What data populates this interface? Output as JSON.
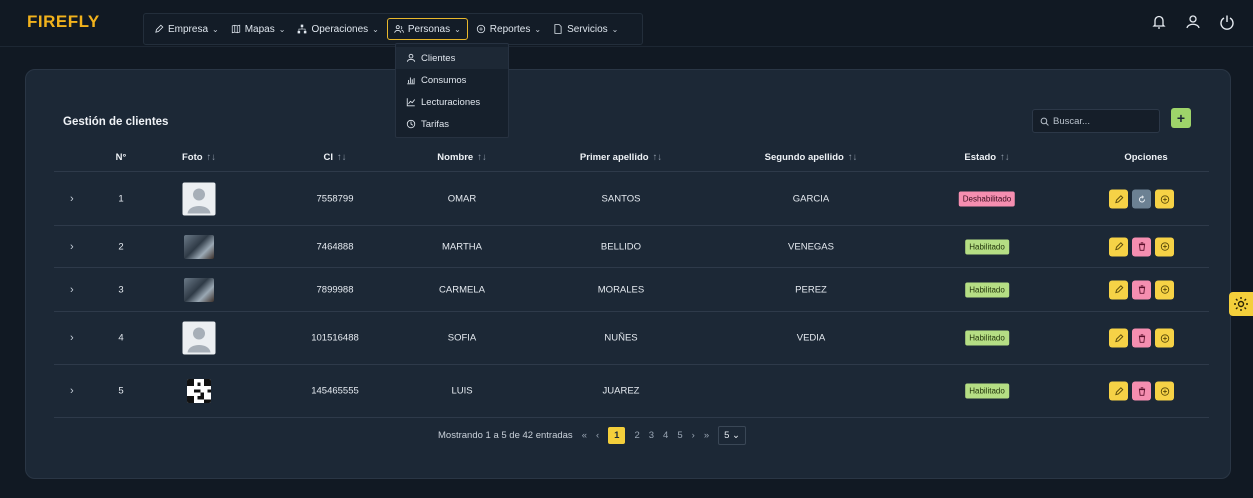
{
  "app": {
    "logo": "FIREFLY"
  },
  "nav": {
    "items": [
      {
        "label": "Empresa",
        "icon": "pencil-icon"
      },
      {
        "label": "Mapas",
        "icon": "map-icon"
      },
      {
        "label": "Operaciones",
        "icon": "network-icon"
      },
      {
        "label": "Personas",
        "icon": "people-icon",
        "active": true
      },
      {
        "label": "Reportes",
        "icon": "report-icon"
      },
      {
        "label": "Servicios",
        "icon": "document-icon"
      }
    ],
    "dropdown": [
      {
        "label": "Clientes",
        "icon": "user-icon"
      },
      {
        "label": "Consumos",
        "icon": "bar-chart-icon"
      },
      {
        "label": "Lecturaciones",
        "icon": "line-chart-icon"
      },
      {
        "label": "Tarifas",
        "icon": "clock-icon"
      }
    ]
  },
  "page": {
    "title": "Gestión de clientes",
    "search_placeholder": "Buscar...",
    "add_label": "+"
  },
  "table": {
    "headers": {
      "num": "N°",
      "foto": "Foto",
      "ci": "CI",
      "nombre": "Nombre",
      "primer": "Primer apellido",
      "segundo": "Segundo apellido",
      "estado": "Estado",
      "opciones": "Opciones"
    },
    "sort_glyph": "↑↓",
    "rows": [
      {
        "n": "1",
        "photo": "avatar",
        "ci": "7558799",
        "nombre": "OMAR",
        "primer": "SANTOS",
        "segundo": "GARCIA",
        "estado": "Deshabilitado",
        "estado_type": "off"
      },
      {
        "n": "2",
        "photo": "pic",
        "ci": "7464888",
        "nombre": "MARTHA",
        "primer": "BELLIDO",
        "segundo": "VENEGAS",
        "estado": "Habilitado",
        "estado_type": "on"
      },
      {
        "n": "3",
        "photo": "pic",
        "ci": "7899988",
        "nombre": "CARMELA",
        "primer": "MORALES",
        "segundo": "PEREZ",
        "estado": "Habilitado",
        "estado_type": "on"
      },
      {
        "n": "4",
        "photo": "avatar",
        "ci": "101516488",
        "nombre": "SOFIA",
        "primer": "NUÑES",
        "segundo": "VEDIA",
        "estado": "Habilitado",
        "estado_type": "on"
      },
      {
        "n": "5",
        "photo": "qr",
        "ci": "145465555",
        "nombre": "LUIS",
        "primer": "JUAREZ",
        "segundo": "",
        "estado": "Habilitado",
        "estado_type": "on"
      }
    ]
  },
  "pagination": {
    "summary": "Mostrando 1 a 5 de 42 entradas",
    "first": "«",
    "prev": "‹",
    "pages": [
      "1",
      "2",
      "3",
      "4",
      "5"
    ],
    "current": "1",
    "next": "›",
    "last": "»",
    "page_size": "5"
  },
  "colors": {
    "accent": "#f4cf3b",
    "enabled": "#b5de84",
    "disabled": "#f58eb0",
    "add": "#9ed46a"
  }
}
